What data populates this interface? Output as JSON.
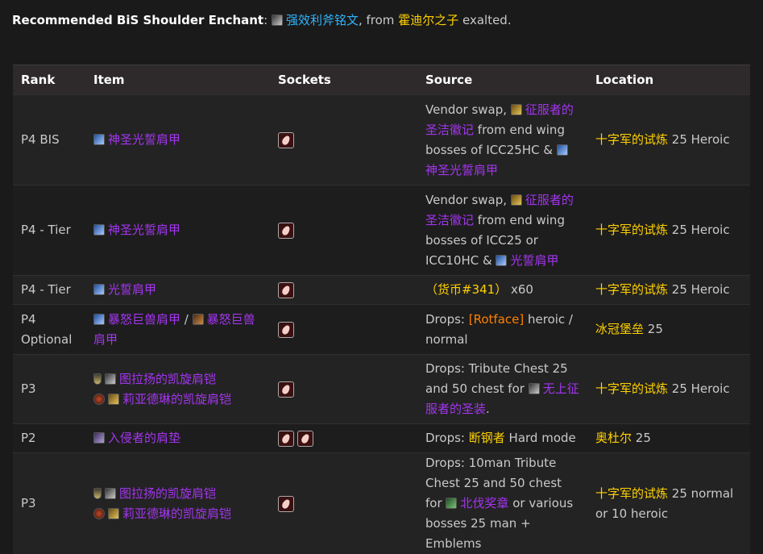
{
  "enchant": {
    "label": "Recommended BiS Shoulder Enchant",
    "colon": ":",
    "item": "强效利斧铭文",
    "from_text": ", from",
    "faction": "霍迪尔之子",
    "standing": "exalted."
  },
  "table": {
    "headers": [
      "Rank",
      "Item",
      "Sockets",
      "Source",
      "Location"
    ],
    "rows": [
      {
        "rank": "P4 BIS",
        "item": "神圣光誓肩甲",
        "src_a": "Vendor swap,",
        "src_token": "征服者的圣洁徽记",
        "src_b": "from end wing bosses of ICC25HC &",
        "src_item": "神圣光誓肩甲",
        "loc_zone": "十字军的试炼",
        "loc_rest": "25 Heroic"
      },
      {
        "rank": "P4 - Tier",
        "item": "神圣光誓肩甲",
        "src_a": "Vendor swap,",
        "src_token": "征服者的圣洁徽记",
        "src_b": "from end wing bosses of ICC25 or ICC10HC &",
        "src_item": "光誓肩甲",
        "loc_zone": "十字军的试炼",
        "loc_rest": "25 Heroic"
      },
      {
        "rank": "P4 - Tier",
        "item": "光誓肩甲",
        "src_currency": "（货币#341）",
        "src_qty": "x60",
        "loc_zone": "十字军的试炼",
        "loc_rest": "25 Heroic"
      },
      {
        "rank": "P4 Optional",
        "item_a": "暴怒巨兽肩甲",
        "sep": "/",
        "item_b": "暴怒巨兽肩甲",
        "src_a": "Drops:",
        "src_boss": "[Rotface]",
        "src_b": "heroic / normal",
        "loc_zone": "冰冠堡垒",
        "loc_rest": "25"
      },
      {
        "rank": "P3",
        "item_a": "图拉扬的凯旋肩铠",
        "item_b": "莉亚德琳的凯旋肩铠",
        "src_a": "Drops: Tribute Chest 25 and 50 chest for",
        "src_item": "无上征服者的圣装",
        "src_b": ".",
        "loc_zone": "十字军的试炼",
        "loc_rest": "25 Heroic"
      },
      {
        "rank": "P2",
        "item": "入侵者的肩垫",
        "src_a": "Drops:",
        "src_boss": "断钢者",
        "src_b": "Hard mode",
        "loc_zone": "奥杜尔",
        "loc_rest": "25"
      },
      {
        "rank": "P3",
        "item_a": "图拉扬的凯旋肩铠",
        "item_b": "莉亚德琳的凯旋肩铠",
        "src_a": "Drops: 10man Tribute Chest 25 and 50 chest for",
        "src_item": "北伐奖章",
        "src_b": "or various bosses 25 man + Emblems",
        "loc_zone": "十字军的试炼",
        "loc_rest": "25 normal or 10 heroic"
      }
    ]
  },
  "colors": {
    "epic": "#a335ee",
    "link": "#2fb5ff",
    "zone": "#ffd100",
    "boss": "#ff8000"
  },
  "icons": [
    "rune-icon",
    "shoulder-icon",
    "emblem-icon",
    "socket-gem-icon",
    "shield-icon",
    "tabard-icon",
    "token-icon"
  ]
}
